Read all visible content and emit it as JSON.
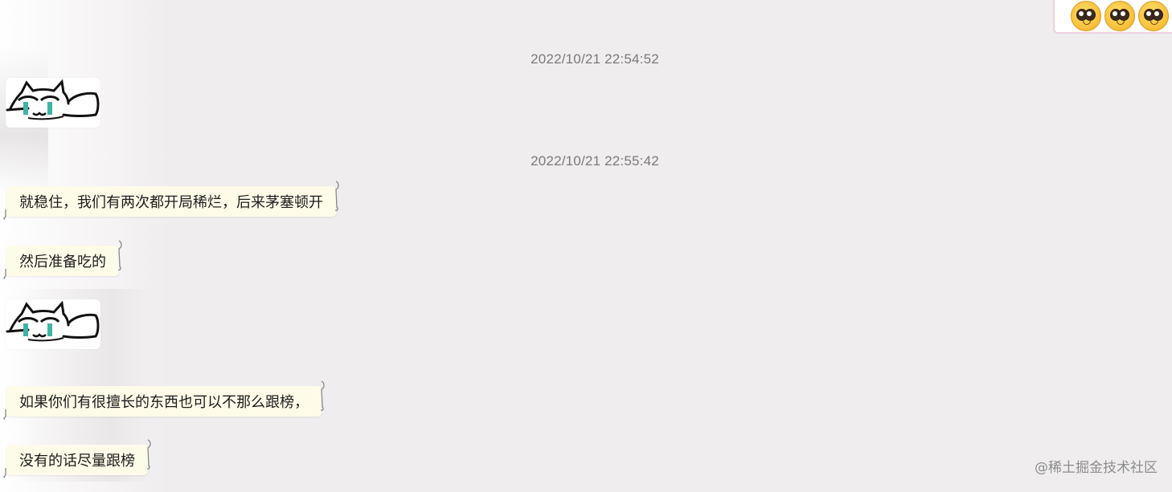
{
  "header": {
    "reaction_sticker_icon": "pleading-face-emoji-row"
  },
  "messages": [
    {
      "type": "timestamp",
      "text": "2022/10/21 22:54:52"
    },
    {
      "type": "sticker",
      "icon": "crying-cat-sticker"
    },
    {
      "type": "timestamp",
      "text": "2022/10/21 22:55:42"
    },
    {
      "type": "text",
      "text": "就稳住，我们有两次都开局稀烂，后来茅塞顿开"
    },
    {
      "type": "text",
      "text": "然后准备吃的"
    },
    {
      "type": "sticker",
      "icon": "crying-cat-sticker"
    },
    {
      "type": "text",
      "text": "如果你们有很擅长的东西也可以不那么跟榜，"
    },
    {
      "type": "text",
      "text": "没有的话尽量跟榜"
    }
  ],
  "watermark": "@稀土掘金技术社区",
  "colors": {
    "background": "#efedee",
    "bubble": "#fffbe9",
    "timestamp": "#7a7a7a"
  }
}
